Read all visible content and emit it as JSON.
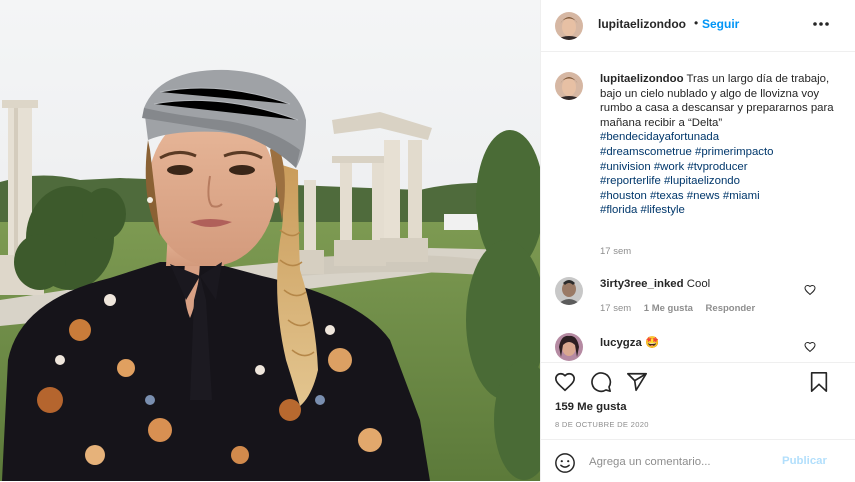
{
  "post": {
    "username": "lupitaelizondoo",
    "separator": "•",
    "follow_label": "Seguir",
    "more_icon": "more-options-icon"
  },
  "caption": {
    "username": "lupitaelizondoo",
    "text": "Tras un largo día de trabajo, bajo un cielo nublado y algo de llovizna voy rumbo a casa a descansar y prepararnos para mañana recibir a “Delta”",
    "hashtags": [
      "#bendecidayafortunada",
      "#dreamscometrue",
      "#primerimpacto",
      "#univision",
      "#work",
      "#tvproducer",
      "#reporterlife",
      "#lupitaelizondo",
      "#houston",
      "#texas",
      "#news",
      "#miami",
      "#florida",
      "#lifestyle"
    ],
    "time": "17 sem"
  },
  "comments": [
    {
      "username": "3irty3ree_inked",
      "text": "Cool",
      "time": "17 sem",
      "likes": "1 Me gusta",
      "reply": "Responder"
    },
    {
      "username": "lucygza",
      "text": "🤩"
    }
  ],
  "actions": {
    "likes": "159 Me gusta",
    "date": "8 DE OCTUBRE DE 2020"
  },
  "add_comment": {
    "placeholder": "Agrega un comentario...",
    "publish": "Publicar"
  },
  "colors": {
    "accent": "#0095f6",
    "hashtag": "#00376b",
    "muted": "#8e8e8e",
    "publish_disabled": "#b2dffc",
    "border": "#efefef"
  }
}
